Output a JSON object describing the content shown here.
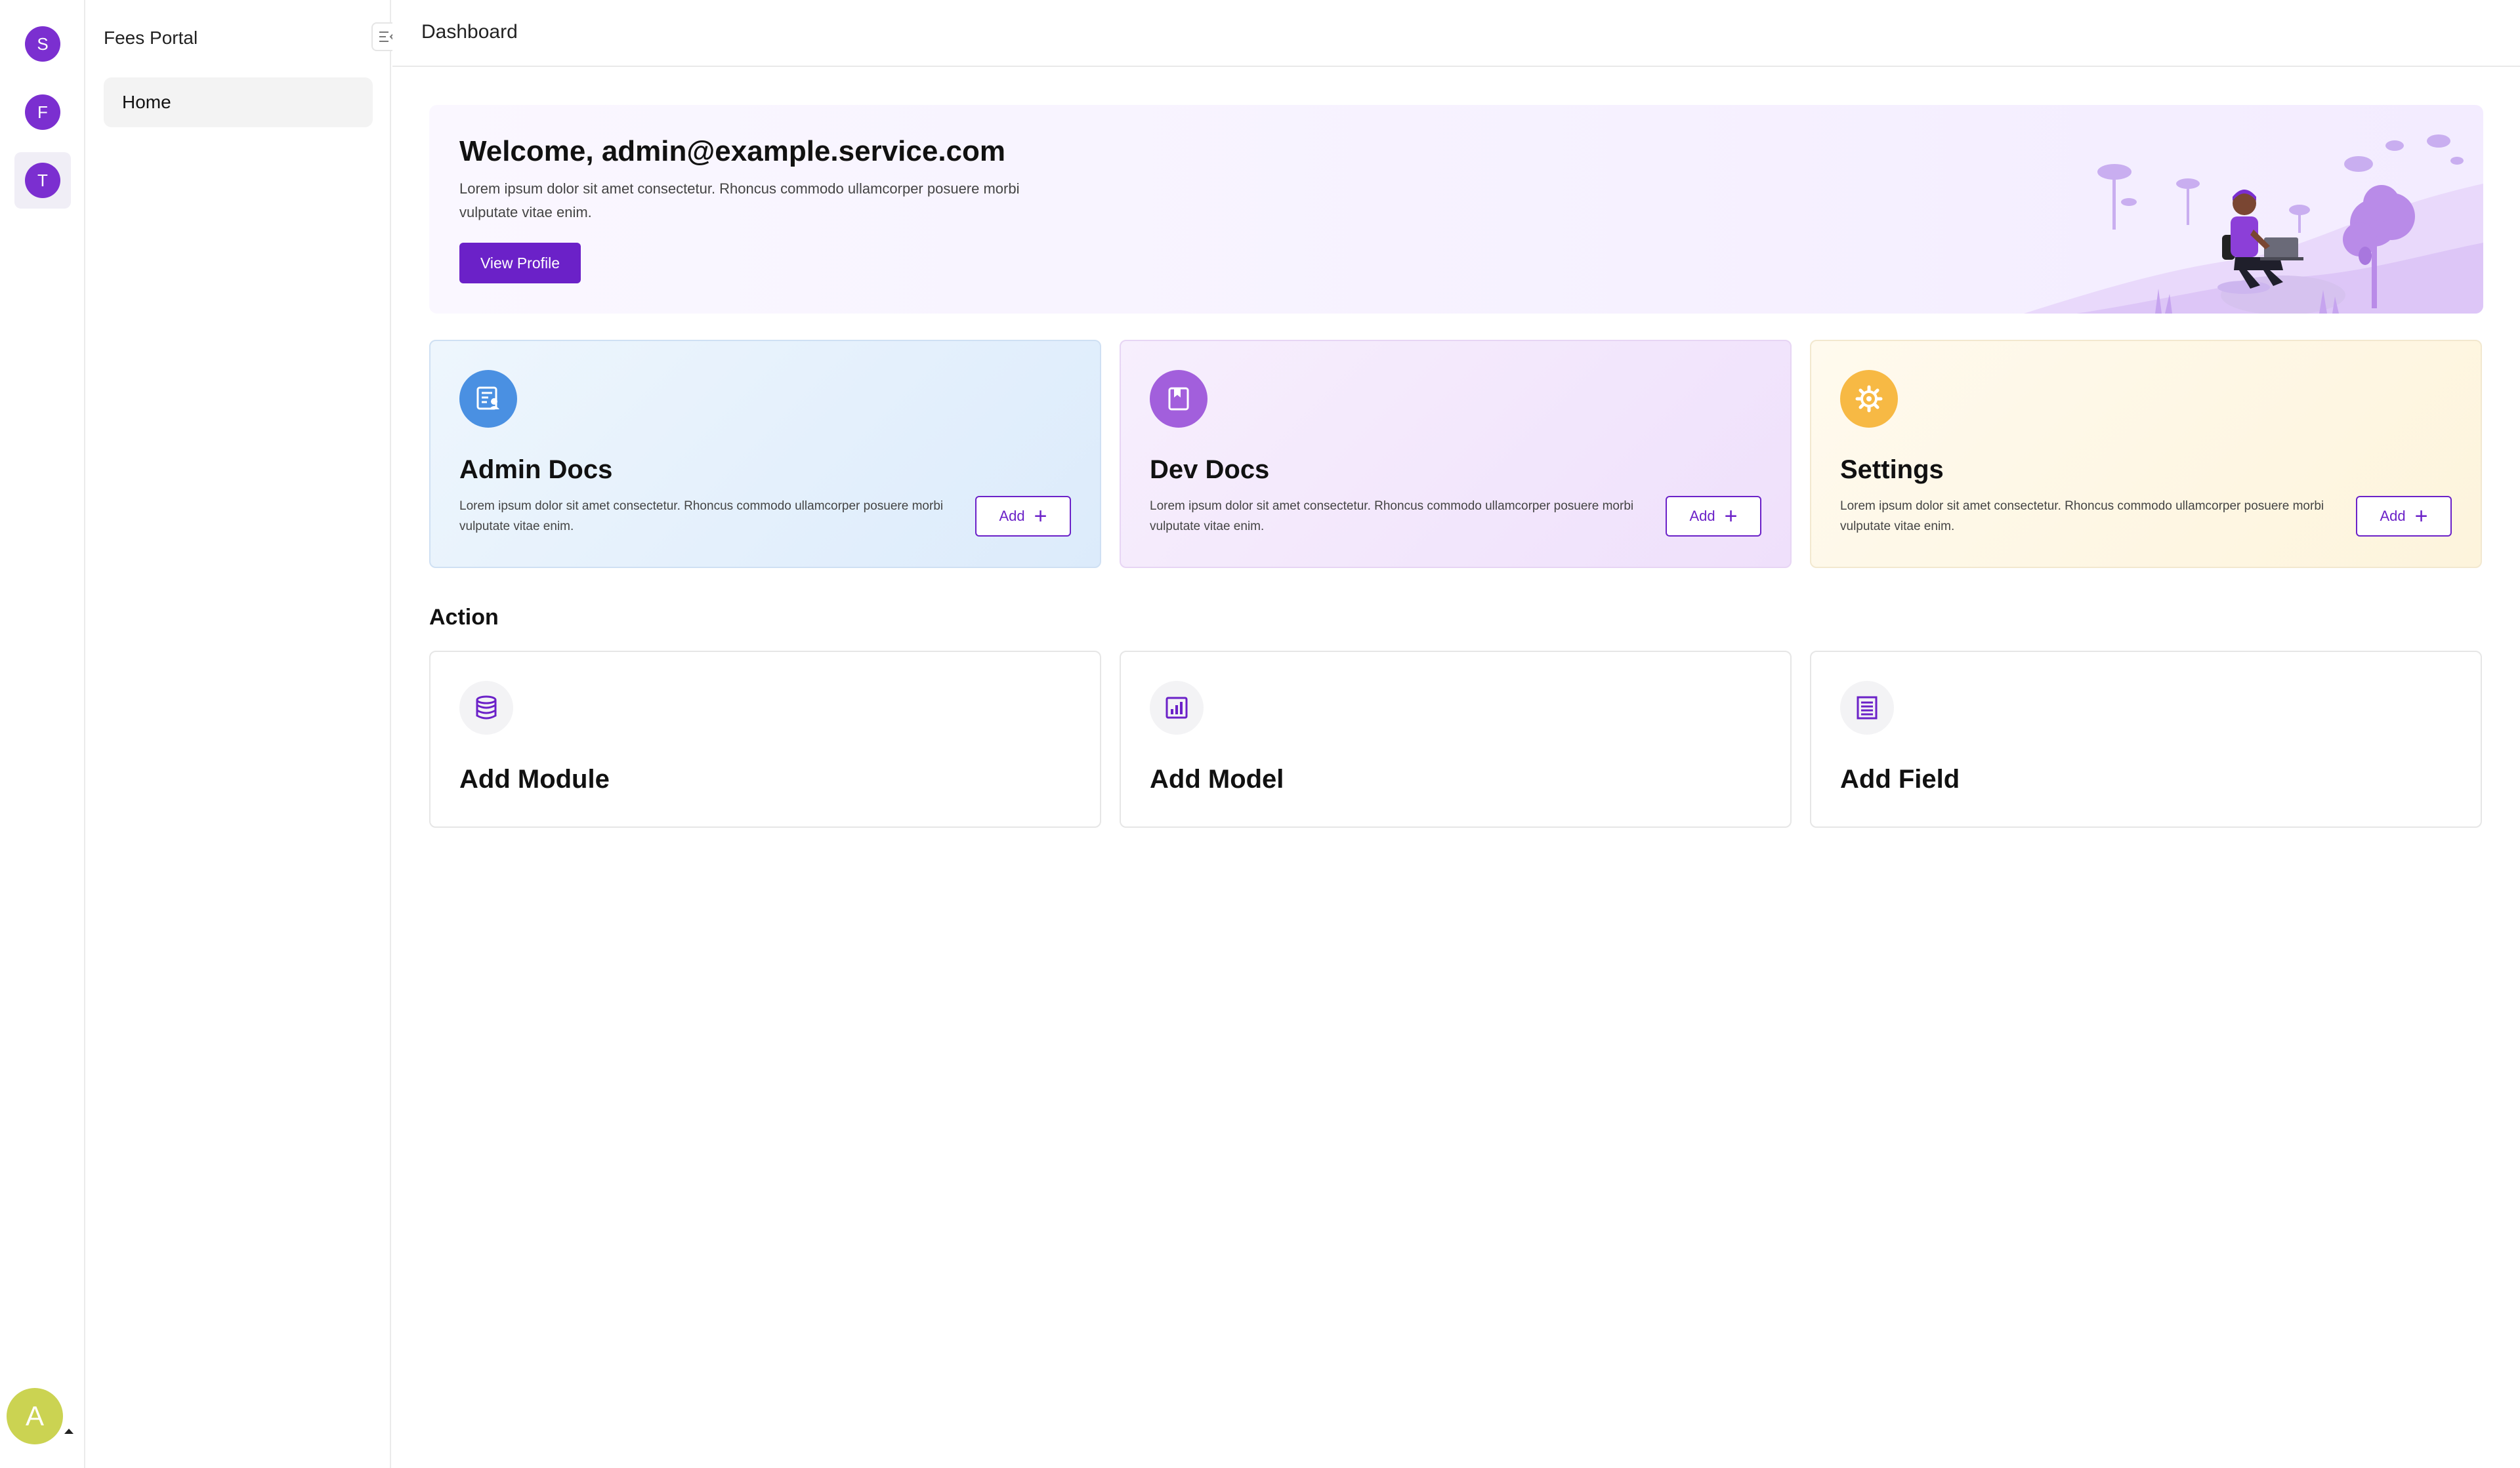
{
  "rail": {
    "items": [
      {
        "initial": "S"
      },
      {
        "initial": "F"
      },
      {
        "initial": "T"
      }
    ],
    "user_initial": "A"
  },
  "sidebar": {
    "title": "Fees Portal",
    "items": [
      {
        "label": "Home"
      }
    ]
  },
  "topbar": {
    "title": "Dashboard"
  },
  "welcome": {
    "heading": "Welcome, admin@example.service.com",
    "text": "Lorem ipsum dolor sit amet consectetur. Rhoncus commodo ullamcorper posuere morbi vulputate vitae enim.",
    "button": "View Profile"
  },
  "cards": [
    {
      "title": "Admin Docs",
      "text": "Lorem ipsum dolor sit amet consectetur. Rhoncus commodo ullamcorper posuere morbi vulputate vitae enim.",
      "button": "Add",
      "icon": "admin-docs-icon",
      "color": "#4a90e2"
    },
    {
      "title": "Dev Docs",
      "text": "Lorem ipsum dolor sit amet consectetur. Rhoncus commodo ullamcorper posuere morbi vulputate vitae enim.",
      "button": "Add",
      "icon": "book-icon",
      "color": "#a25fdc"
    },
    {
      "title": "Settings",
      "text": "Lorem ipsum dolor sit amet consectetur. Rhoncus commodo ullamcorper posuere morbi vulputate vitae enim.",
      "button": "Add",
      "icon": "gear-icon",
      "color": "#f7b944"
    }
  ],
  "action": {
    "title": "Action",
    "items": [
      {
        "label": "Add Module",
        "icon": "database-icon"
      },
      {
        "label": "Add Model",
        "icon": "chart-icon"
      },
      {
        "label": "Add Field",
        "icon": "list-icon"
      }
    ]
  },
  "colors": {
    "accent": "#6b21c8",
    "rail_avatar": "#7b2fd0",
    "user_avatar": "#cbd352"
  }
}
